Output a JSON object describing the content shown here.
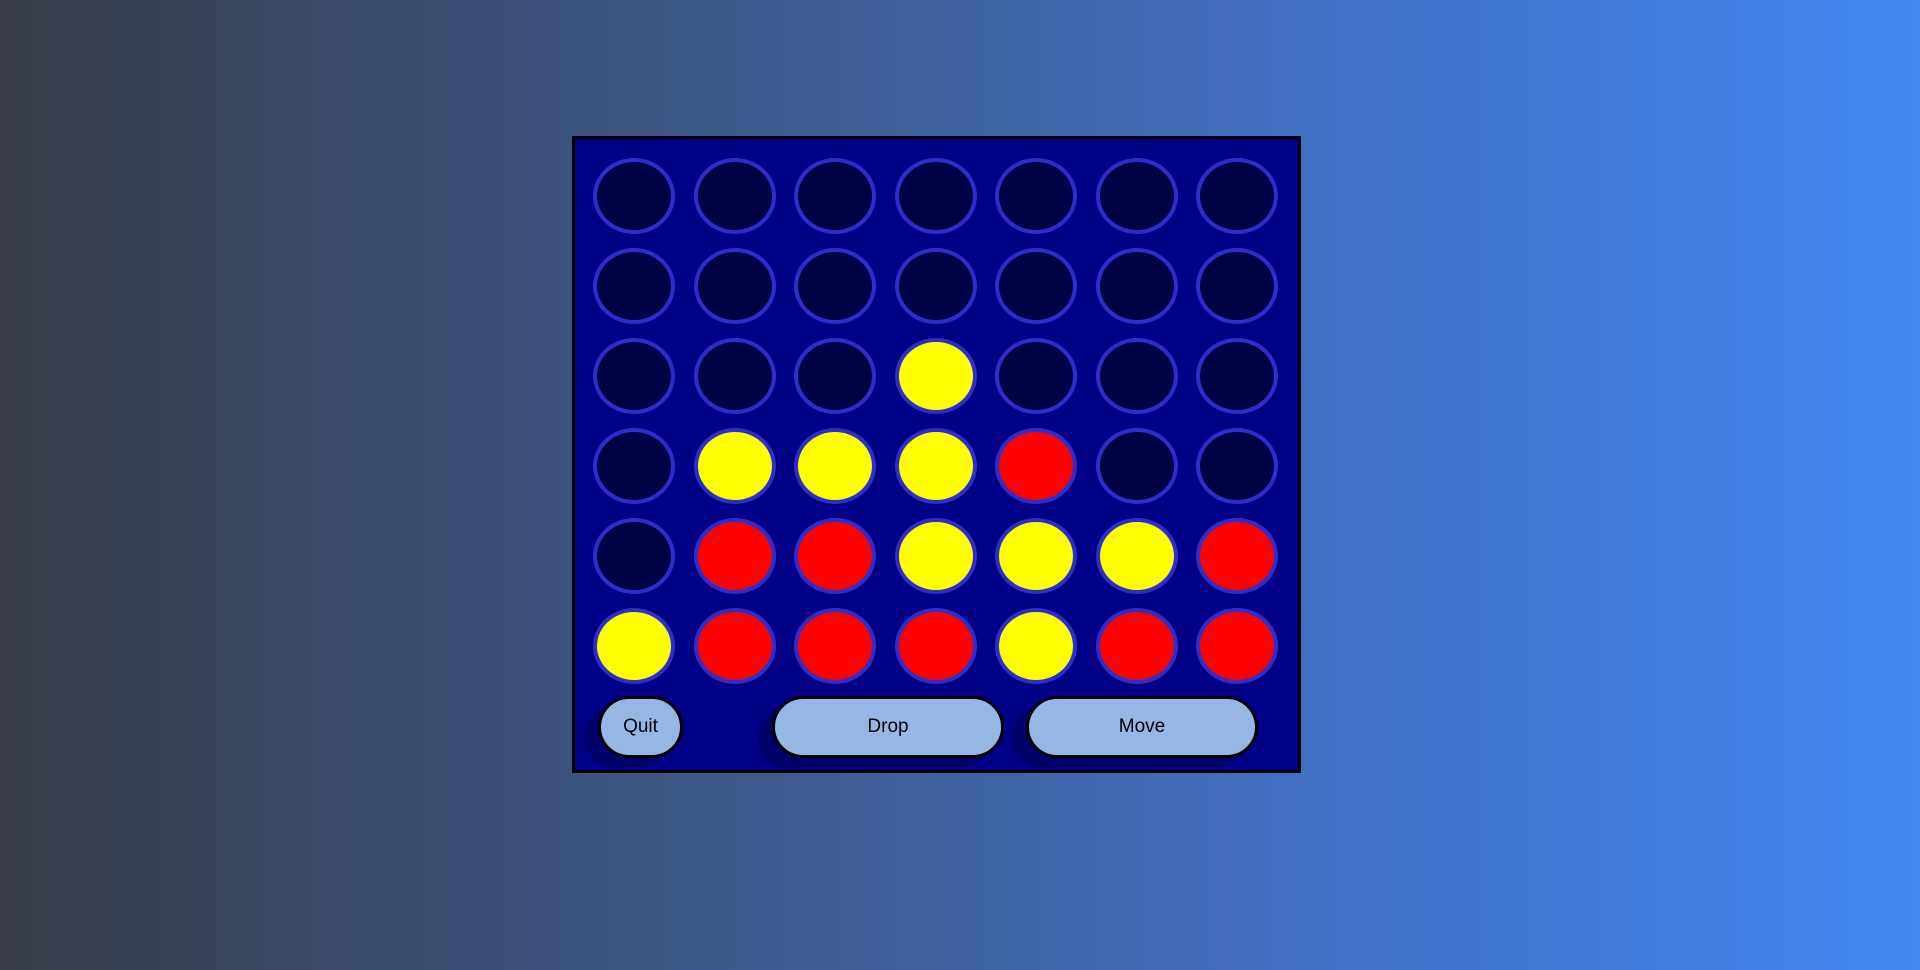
{
  "colors": {
    "board": "#000087",
    "empty_slot": "#000044",
    "slot_ring": "#2d2dcc",
    "yellow_disc": "#ffff00",
    "red_disc": "#ff0000",
    "button_fill": "#95b7e6"
  },
  "board": {
    "rows": [
      [
        "empty",
        "empty",
        "empty",
        "empty",
        "empty",
        "empty",
        "empty"
      ],
      [
        "empty",
        "empty",
        "empty",
        "empty",
        "empty",
        "empty",
        "empty"
      ],
      [
        "empty",
        "empty",
        "empty",
        "yellow",
        "empty",
        "empty",
        "empty"
      ],
      [
        "empty",
        "yellow",
        "yellow",
        "yellow",
        "red",
        "empty",
        "empty"
      ],
      [
        "empty",
        "red",
        "red",
        "yellow",
        "yellow",
        "yellow",
        "red"
      ],
      [
        "yellow",
        "red",
        "red",
        "red",
        "yellow",
        "red",
        "red"
      ]
    ]
  },
  "controls": {
    "quit_label": "Quit",
    "drop_label": "Drop",
    "move_label": "Move"
  }
}
